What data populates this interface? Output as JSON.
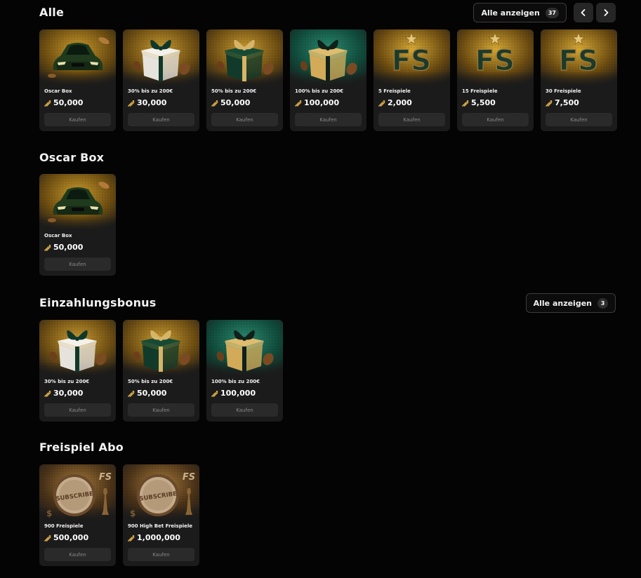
{
  "colors": {
    "background": "#040404",
    "card": "#1b1b1b",
    "gold": "#c9a24a",
    "green": "#0f3b2b",
    "button": "#2a2a2a"
  },
  "sections": {
    "alle": {
      "title": "Alle",
      "show_all_label": "Alle anzeigen",
      "count": "37",
      "cards": [
        {
          "name": "Oscar Box",
          "price": "50,000",
          "buy": "Kaufen",
          "image": "car"
        },
        {
          "name": "30% bis zu 200€",
          "price": "30,000",
          "buy": "Kaufen",
          "image": "gift-white"
        },
        {
          "name": "50% bis zu 200€",
          "price": "50,000",
          "buy": "Kaufen",
          "image": "gift-green"
        },
        {
          "name": "100% bis zu 200€",
          "price": "100,000",
          "buy": "Kaufen",
          "image": "gift-gold"
        },
        {
          "name": "5 Freispiele",
          "price": "2,000",
          "buy": "Kaufen",
          "image": "fs"
        },
        {
          "name": "15 Freispiele",
          "price": "5,500",
          "buy": "Kaufen",
          "image": "fs"
        },
        {
          "name": "30 Freispiele",
          "price": "7,500",
          "buy": "Kaufen",
          "image": "fs"
        }
      ]
    },
    "oscar": {
      "title": "Oscar Box",
      "cards": [
        {
          "name": "Oscar Box",
          "price": "50,000",
          "buy": "Kaufen",
          "image": "car"
        }
      ]
    },
    "einzahlung": {
      "title": "Einzahlungsbonus",
      "show_all_label": "Alle anzeigen",
      "count": "3",
      "cards": [
        {
          "name": "30% bis zu 200€",
          "price": "30,000",
          "buy": "Kaufen",
          "image": "gift-white"
        },
        {
          "name": "50% bis zu 200€",
          "price": "50,000",
          "buy": "Kaufen",
          "image": "gift-green"
        },
        {
          "name": "100% bis zu 200€",
          "price": "100,000",
          "buy": "Kaufen",
          "image": "gift-gold"
        }
      ]
    },
    "abo": {
      "title": "Freispiel Abo",
      "cards": [
        {
          "name": "900 Freispiele",
          "price": "500,000",
          "buy": "Kaufen",
          "image": "subscribe",
          "image_text": "SUBSCRIBE",
          "badge_text": "FS"
        },
        {
          "name": "900 High Bet Freispiele",
          "price": "1,000,000",
          "buy": "Kaufen",
          "image": "subscribe",
          "image_text": "SUBSCRIBE",
          "badge_text": "FS"
        }
      ]
    }
  },
  "fs_logo_text": "FS"
}
